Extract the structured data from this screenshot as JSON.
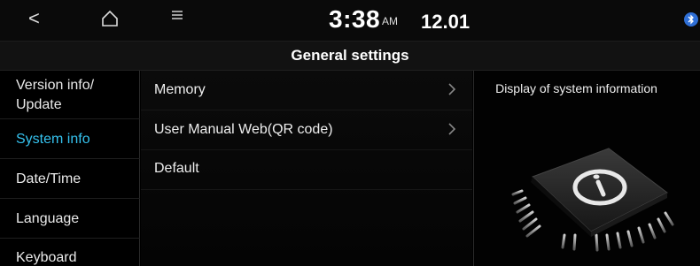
{
  "status": {
    "time": "3:38",
    "ampm": "AM",
    "date": "12.01"
  },
  "icons": {
    "back": "back-icon",
    "home": "home-icon",
    "menu": "menu-icon",
    "bluetooth": "bluetooth-icon",
    "chevron": "chevron-right-icon",
    "chip": "system-info-chip-icon"
  },
  "title": "General settings",
  "sidebar": {
    "items": [
      {
        "label": "Version info/\nUpdate",
        "active": false
      },
      {
        "label": "System info",
        "active": true
      },
      {
        "label": "Date/Time",
        "active": false
      },
      {
        "label": "Language",
        "active": false
      },
      {
        "label": "Keyboard",
        "active": false
      }
    ]
  },
  "list": {
    "items": [
      {
        "label": "Memory",
        "has_chevron": true
      },
      {
        "label": "User Manual Web(QR code)",
        "has_chevron": true
      },
      {
        "label": "Default",
        "has_chevron": false
      }
    ]
  },
  "detail": {
    "caption": "Display of system information"
  },
  "colors": {
    "accent": "#35c2ee",
    "background": "#000000",
    "text": "#eeeeee"
  }
}
